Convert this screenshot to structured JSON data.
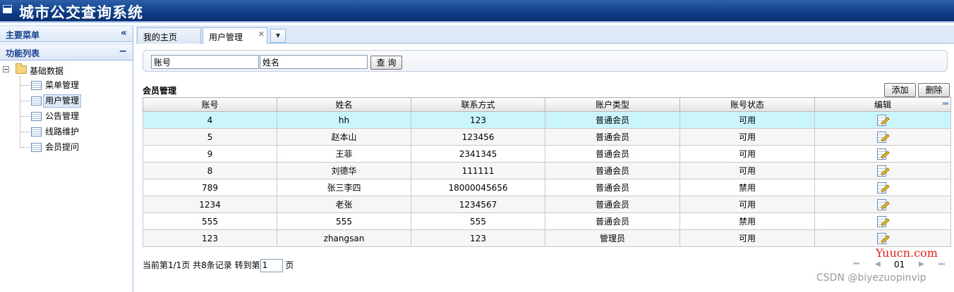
{
  "header": {
    "title": "城市公交查询系统"
  },
  "sidebar": {
    "main_menu_label": "主要菜单",
    "collapse_glyph": "«",
    "function_list_label": "功能列表",
    "function_list_glyph": "−",
    "tree": {
      "root_label": "基础数据",
      "items": [
        {
          "label": "菜单管理"
        },
        {
          "label": "用户管理"
        },
        {
          "label": "公告管理"
        },
        {
          "label": "线路维护"
        },
        {
          "label": "会员提问"
        }
      ],
      "selected_index": 1
    }
  },
  "tabs": [
    {
      "label": "我的主页"
    },
    {
      "label": "用户管理",
      "close_glyph": "✕"
    }
  ],
  "tab_menu_glyph": "▼",
  "search": {
    "account_value": "账号",
    "name_value": "姓名",
    "search_button": "查 询"
  },
  "grid": {
    "title": "会员管理",
    "add_button": "添加",
    "delete_button": "删除",
    "column_toggle_glyph": "»»",
    "columns": [
      "账号",
      "姓名",
      "联系方式",
      "账户类型",
      "账号状态",
      "编辑"
    ],
    "rows": [
      {
        "account": "4",
        "name": "hh",
        "contact": "123",
        "type": "普通会员",
        "status": "可用"
      },
      {
        "account": "5",
        "name": "赵本山",
        "contact": "123456",
        "type": "普通会员",
        "status": "可用"
      },
      {
        "account": "9",
        "name": "王菲",
        "contact": "2341345",
        "type": "普通会员",
        "status": "可用"
      },
      {
        "account": "8",
        "name": "刘德华",
        "contact": "111111",
        "type": "普通会员",
        "status": "可用"
      },
      {
        "account": "789",
        "name": "张三李四",
        "contact": "18000045656",
        "type": "普通会员",
        "status": "禁用"
      },
      {
        "account": "1234",
        "name": "老张",
        "contact": "1234567",
        "type": "普通会员",
        "status": "可用"
      },
      {
        "account": "555",
        "name": "555",
        "contact": "555",
        "type": "普通会员",
        "status": "禁用"
      },
      {
        "account": "123",
        "name": "zhangsan",
        "contact": "123",
        "type": "管理员",
        "status": "可用"
      }
    ],
    "highlight_row_index": 0
  },
  "pager": {
    "info": "当前第1/1页 共8条记录 转到第",
    "goto_value": "1",
    "page_suffix": "页",
    "current_page": "01",
    "first_glyph": "⏮",
    "prev_glyph": "◀",
    "next_glyph": "▶",
    "last_glyph": "⏭"
  },
  "watermarks": {
    "site": "Yuucn.com",
    "csdn": "CSDN @biyezuopinvip"
  }
}
